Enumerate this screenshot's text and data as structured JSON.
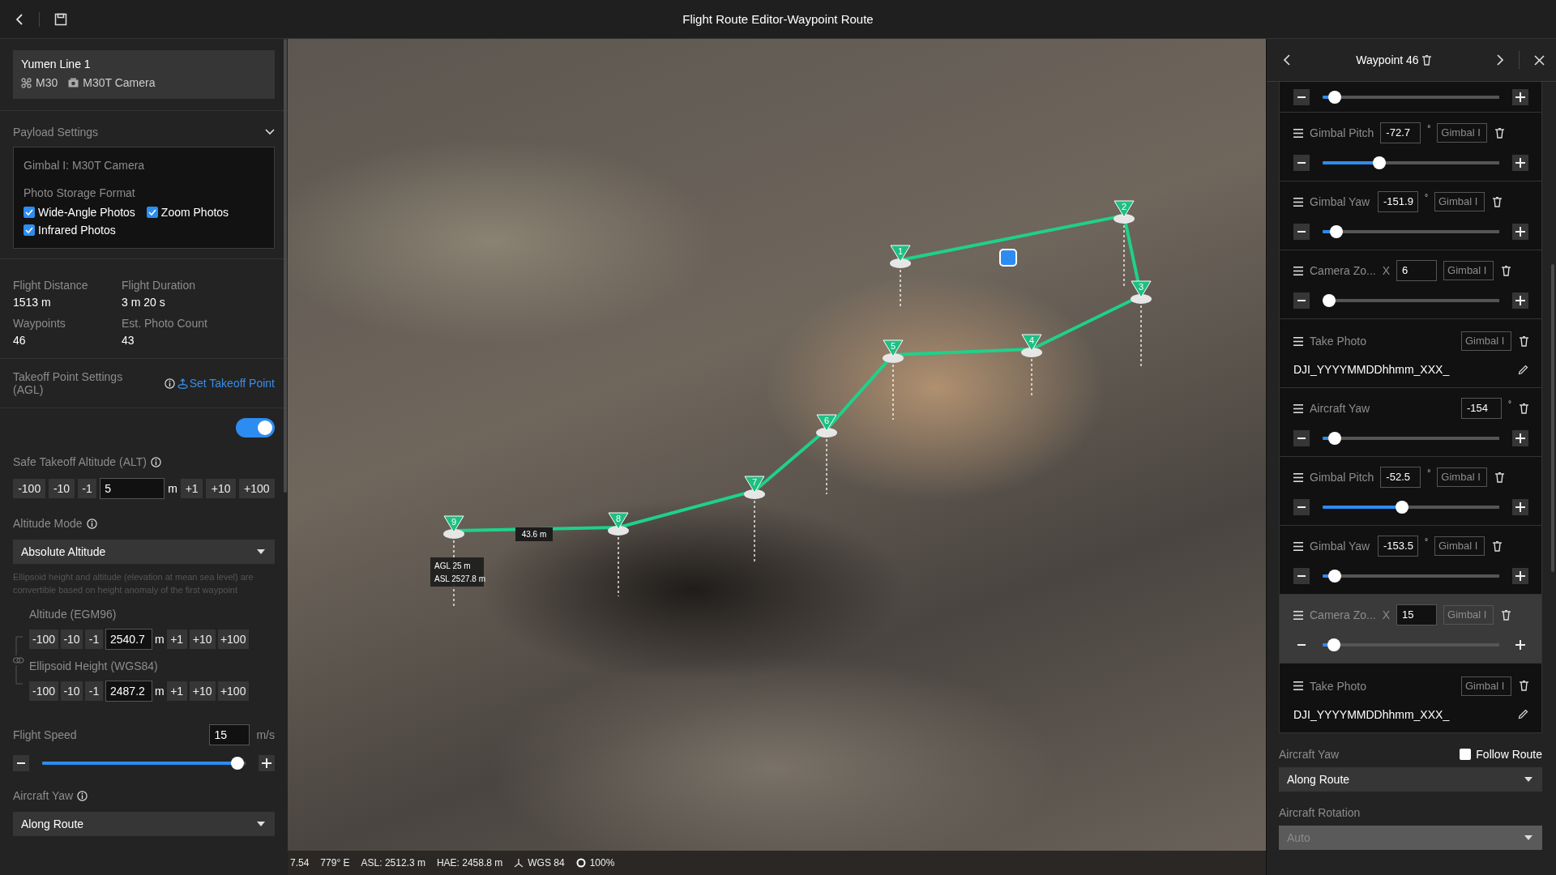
{
  "window": {
    "title": "Flight Route Editor-Waypoint Route"
  },
  "route_card": {
    "name": "Yumen Line 1",
    "aircraft": "M30",
    "camera": "M30T Camera"
  },
  "payload_settings": {
    "title": "Payload Settings",
    "expanded": true,
    "gimbal": "Gimbal I: M30T Camera",
    "storage_label": "Photo Storage Format",
    "formats": [
      {
        "label": "Wide-Angle Photos",
        "checked": true
      },
      {
        "label": "Zoom Photos",
        "checked": true
      },
      {
        "label": "Infrared Photos",
        "checked": true
      }
    ]
  },
  "stats": [
    {
      "label": "Flight Distance",
      "value": "1513 m"
    },
    {
      "label": "Flight Duration",
      "value": "3 m 20 s"
    },
    {
      "label": "Waypoints",
      "value": "46"
    },
    {
      "label": "Est. Photo Count",
      "value": "43"
    }
  ],
  "takeoff": {
    "label": "Takeoff Point Settings (AGL)",
    "link": "Set Takeoff Point",
    "on": true
  },
  "safe_takeoff": {
    "label": "Safe Takeoff Altitude (ALT)",
    "value": "5",
    "unit": "m",
    "decrements": [
      "-100",
      "-10",
      "-1"
    ],
    "increments": [
      "+1",
      "+10",
      "+100"
    ]
  },
  "altitude_mode": {
    "label": "Altitude Mode",
    "value": "Absolute Altitude",
    "note": "Ellipsoid height and altitude (elevation at mean sea level) are convertible based on height anomaly of the first waypoint",
    "heights": [
      {
        "label": "Altitude (EGM96)",
        "value": "2540.7",
        "unit": "m",
        "decrements": [
          "-100",
          "-10",
          "-1"
        ],
        "increments": [
          "+1",
          "+10",
          "+100"
        ]
      },
      {
        "label": "Ellipsoid Height (WGS84)",
        "value": "2487.2",
        "unit": "m",
        "decrements": [
          "-100",
          "-10",
          "-1"
        ],
        "increments": [
          "+1",
          "+10",
          "+100"
        ]
      }
    ]
  },
  "flight_speed": {
    "label": "Flight Speed",
    "value": "15",
    "unit": "m/s",
    "level": 0.96
  },
  "aircraft_yaw": {
    "label": "Aircraft Yaw",
    "value": "Along Route"
  },
  "map": {
    "waypoints": [
      {
        "label": "1"
      },
      {
        "label": "2"
      },
      {
        "label": "3"
      },
      {
        "label": "4"
      },
      {
        "label": "5"
      },
      {
        "label": "6"
      },
      {
        "label": "7"
      },
      {
        "label": "8"
      },
      {
        "label": "9"
      }
    ],
    "segment_distance": "43.6 m",
    "agl": "AGL 25 m",
    "asl": "ASL 2527.8 m"
  },
  "status_bar": {
    "latitude": "7.54",
    "longitude": "779° E",
    "asl": "ASL: 2512.3 m",
    "hae": "HAE: 2458.8 m",
    "datum": "WGS 84",
    "zoom": "100%"
  },
  "waypoint_panel": {
    "title": "Waypoint 46",
    "actions": [
      {
        "kind": "slider",
        "selected": false,
        "level": 0.07
      },
      {
        "kind": "angle",
        "selected": false,
        "label": "Gimbal Pitch",
        "value": "-72.7",
        "unit": "°",
        "target": "Gimbal I",
        "level": 0.32
      },
      {
        "kind": "angle",
        "selected": false,
        "label": "Gimbal Yaw",
        "value": "-151.9",
        "unit": "°",
        "target": "Gimbal I",
        "level": 0.08
      },
      {
        "kind": "zoom",
        "selected": false,
        "label": "Camera Zo...",
        "prefix": "X",
        "value": "6",
        "target": "Gimbal I",
        "level": 0.02
      },
      {
        "kind": "photo",
        "selected": false,
        "label": "Take Photo",
        "target": "Gimbal I",
        "filename": "DJI_YYYYMMDDhhmm_XXX_"
      },
      {
        "kind": "yaw",
        "selected": false,
        "label": "Aircraft Yaw",
        "value": "-154",
        "unit": "°",
        "level": 0.07
      },
      {
        "kind": "angle",
        "selected": false,
        "label": "Gimbal Pitch",
        "value": "-52.5",
        "unit": "°",
        "target": "Gimbal I",
        "level": 0.45
      },
      {
        "kind": "angle",
        "selected": false,
        "label": "Gimbal Yaw",
        "value": "-153.5",
        "unit": "°",
        "target": "Gimbal I",
        "level": 0.07
      },
      {
        "kind": "zoom",
        "selected": true,
        "label": "Camera Zo...",
        "prefix": "X",
        "value": "15",
        "target": "Gimbal I",
        "level": 0.065
      },
      {
        "kind": "photo",
        "selected": false,
        "label": "Take Photo",
        "target": "Gimbal I",
        "filename": "DJI_YYYYMMDDhhmm_XXX_"
      }
    ],
    "aircraft_yaw": {
      "label": "Aircraft Yaw",
      "follow_label": "Follow Route",
      "follow_checked": false,
      "value": "Along Route"
    },
    "aircraft_rotation": {
      "label": "Aircraft Rotation",
      "value": "Auto",
      "disabled": true
    }
  }
}
